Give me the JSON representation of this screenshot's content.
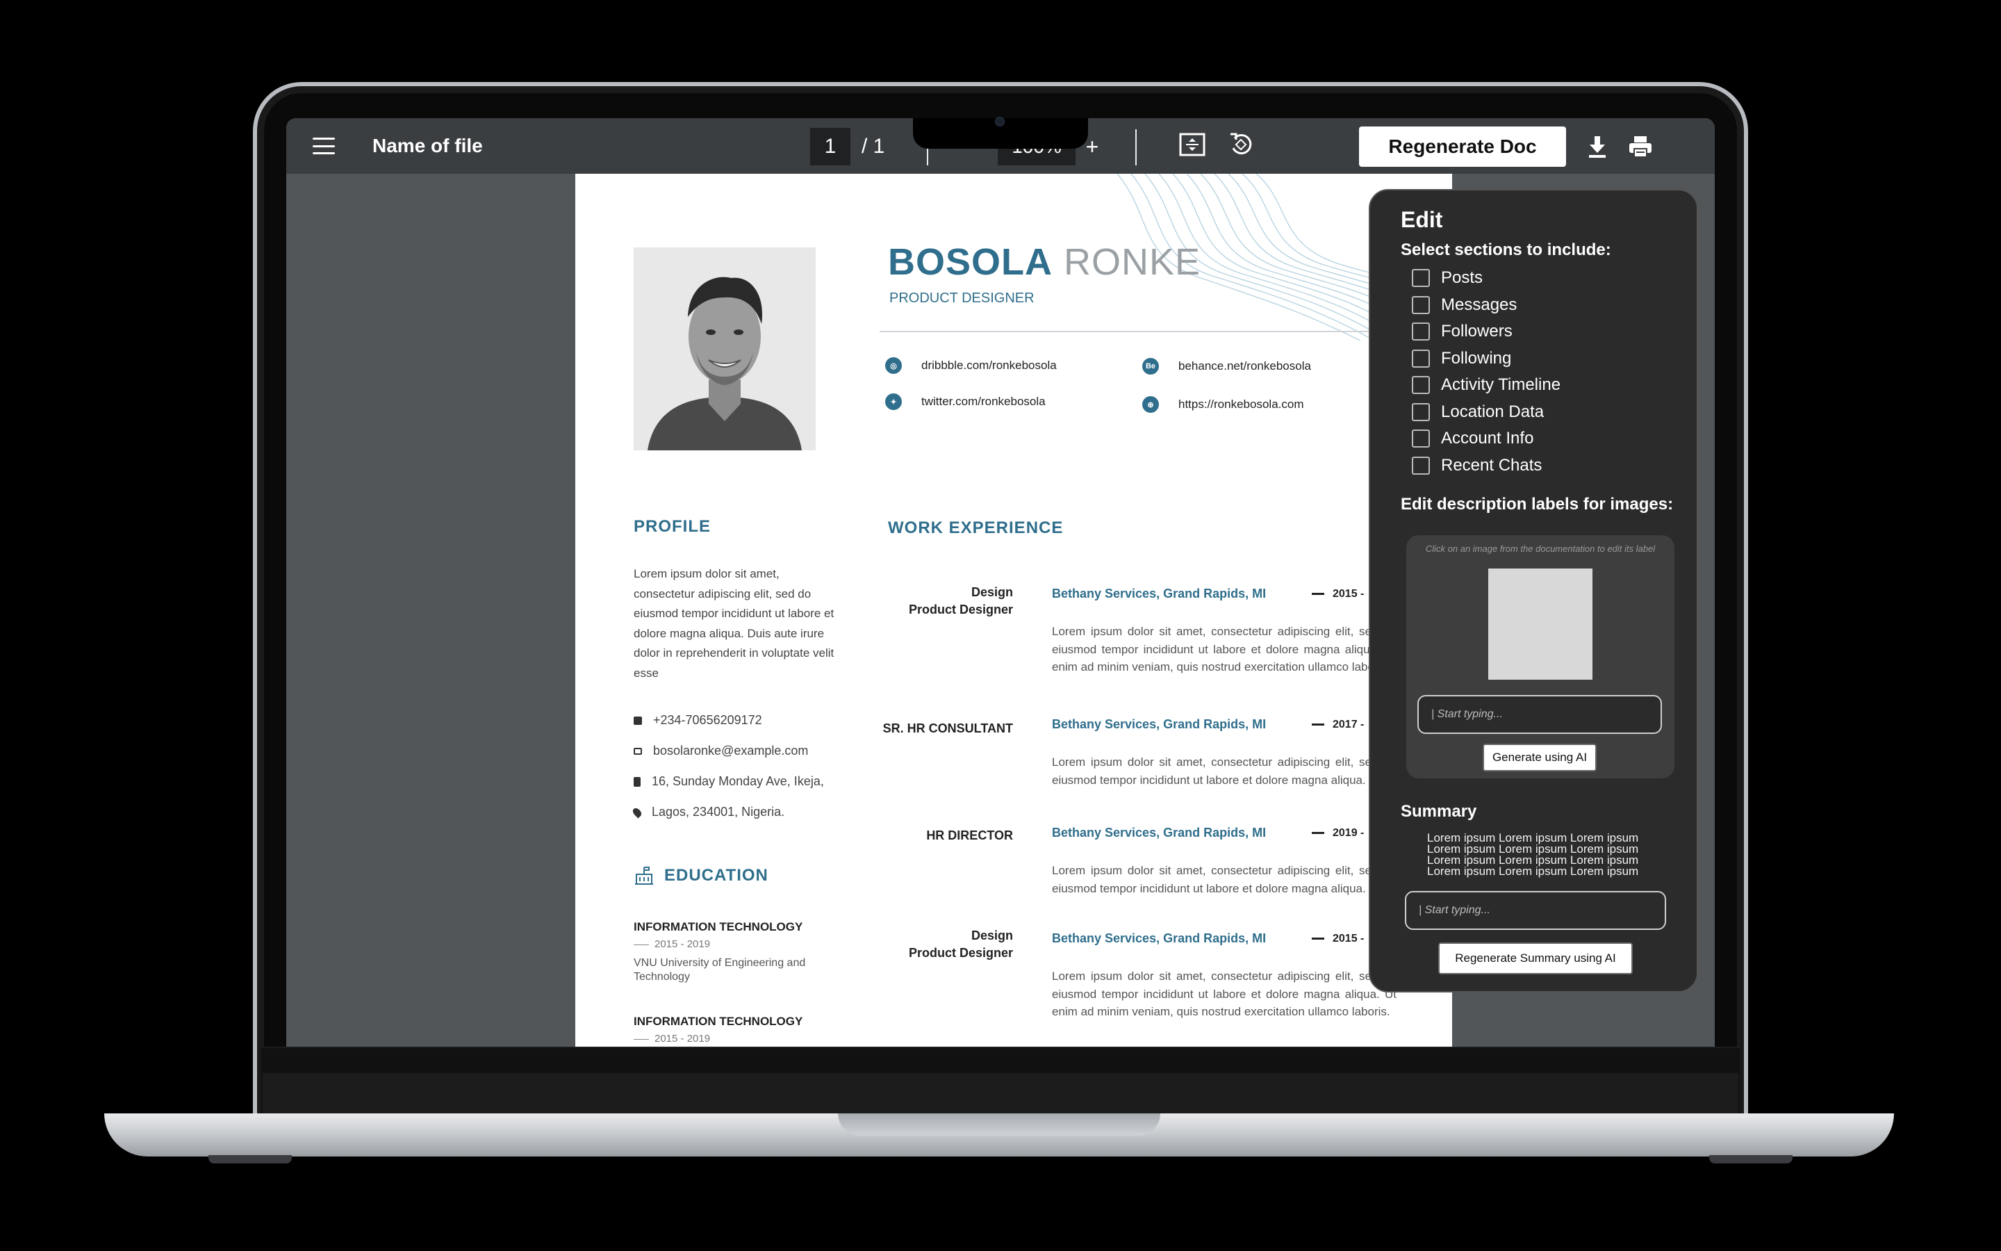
{
  "toolbar": {
    "file_name": "Name of file",
    "page_current": "1",
    "page_total": "/  1",
    "zoom": "100%",
    "zoom_in": "+",
    "regenerate_doc_label": "Regenerate Doc"
  },
  "resume": {
    "first_name": "BOSOLA",
    "last_name": "RONKE",
    "role": "PRODUCT DESIGNER",
    "links": [
      {
        "icon": "dribbble-icon",
        "text": "dribbble.com/ronkebosola"
      },
      {
        "icon": "behance-icon",
        "glyph": "Be",
        "text": "behance.net/ronkebosola"
      },
      {
        "icon": "twitter-icon",
        "text": "twitter.com/ronkebosola"
      },
      {
        "icon": "globe-icon",
        "text": "https://ronkebosola.com"
      }
    ],
    "profile_title": "PROFILE",
    "profile_text": "Lorem ipsum dolor sit amet, consectetur adipiscing elit, sed do eiusmod tempor incididunt ut labore et dolore magna aliqua. Duis aute irure dolor in reprehenderit in voluptate velit esse",
    "contacts": [
      {
        "icon": "phone-icon",
        "text": "+234-70656209172"
      },
      {
        "icon": "mail-icon",
        "text": "bosolaronke@example.com"
      },
      {
        "icon": "building-icon",
        "text": "16, Sunday Monday Ave, Ikeja,"
      },
      {
        "icon": "location-pin-icon",
        "text": "Lagos, 234001, Nigeria."
      }
    ],
    "education_title": "EDUCATION",
    "education": [
      {
        "title": "INFORMATION TECHNOLOGY",
        "years": "2015 - 2019",
        "school": "VNU University of Engineering and Technology"
      },
      {
        "title": "INFORMATION TECHNOLOGY",
        "years": "2015 - 2019"
      }
    ],
    "work_title": "WORK EXPERIENCE",
    "jobs": [
      {
        "role": "Design\nProduct Designer",
        "company": "Bethany Services, Grand Rapids, MI",
        "year": "2015 -",
        "desc": "Lorem ipsum dolor sit amet, consectetur adipiscing elit, sed do eiusmod tempor incididunt ut labore et dolore magna aliqua. Ut enim ad minim veniam, quis nostrud exercitation ullamco laboris."
      },
      {
        "role": "SR. HR CONSULTANT",
        "company": "Bethany Services, Grand Rapids, MI",
        "year": "2017 -",
        "desc": "Lorem ipsum dolor sit amet, consectetur adipiscing elit, sed do eiusmod tempor incididunt ut labore et dolore magna aliqua."
      },
      {
        "role": "HR DIRECTOR",
        "company": "Bethany Services, Grand Rapids, MI",
        "year": "2019 -",
        "desc": "Lorem ipsum dolor sit amet, consectetur adipiscing elit, sed do eiusmod tempor incididunt ut labore et dolore magna aliqua."
      },
      {
        "role": "Design\nProduct Designer",
        "company": "Bethany Services, Grand Rapids, MI",
        "year": "2015 -",
        "desc": "Lorem ipsum dolor sit amet, consectetur adipiscing elit, sed do eiusmod tempor incididunt ut labore et dolore magna aliqua. Ut enim ad minim veniam, quis nostrud exercitation ullamco laboris."
      }
    ]
  },
  "edit_panel": {
    "title": "Edit",
    "sections_label": "Select sections to include:",
    "sections": [
      "Posts",
      "Messages",
      "Followers",
      "Following",
      "Activity Timeline",
      "Location Data",
      "Account Info",
      "Recent Chats"
    ],
    "image_labels_title": "Edit description labels for images:",
    "image_hint": "Click on an image from the documentation to edit its label",
    "image_input_placeholder": "| Start typing...",
    "generate_ai_label": "Generate using AI",
    "summary_title": "Summary",
    "summary_text": "Lorem ipsum Lorem ipsum Lorem ipsum Lorem ipsum Lorem ipsum Lorem ipsum Lorem ipsum Lorem ipsum Lorem ipsum Lorem ipsum Lorem ipsum Lorem ipsum",
    "summary_input_placeholder": "| Start typing...",
    "regenerate_summary_label": "Regenerate Summary using AI"
  },
  "colors": {
    "accent": "#2f6e8c",
    "toolbar_bg": "#3b3e41",
    "viewer_bg": "#525659",
    "panel_bg": "#2b2b2b"
  }
}
